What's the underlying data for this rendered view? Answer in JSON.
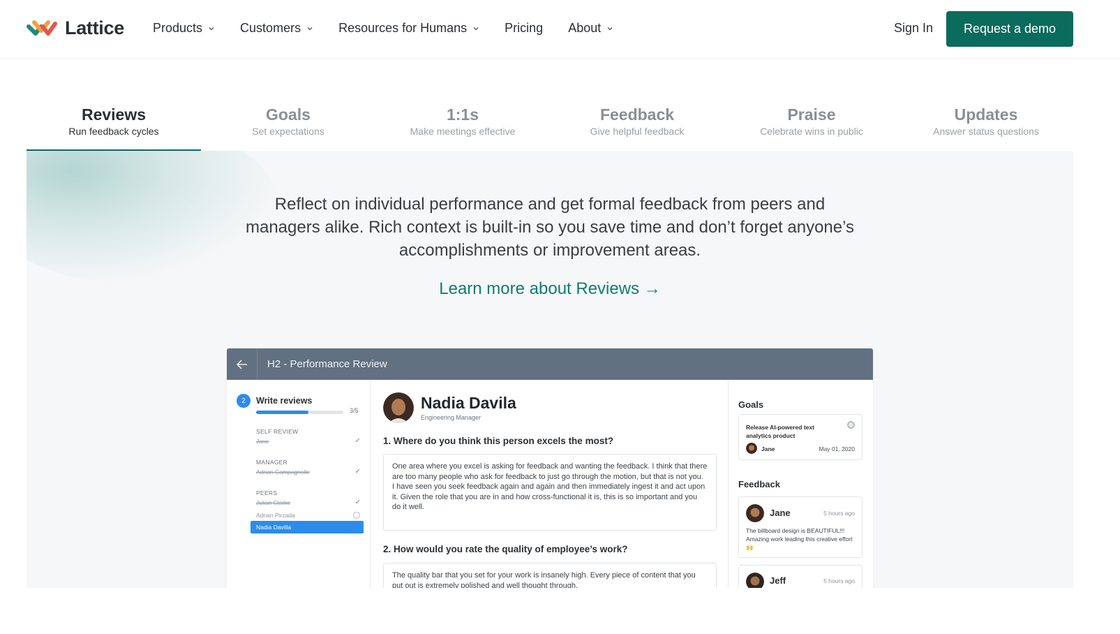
{
  "nav": {
    "brand": "Lattice",
    "menu": [
      {
        "label": "Products",
        "has_dropdown": true
      },
      {
        "label": "Customers",
        "has_dropdown": true
      },
      {
        "label": "Resources for Humans",
        "has_dropdown": true
      },
      {
        "label": "Pricing",
        "has_dropdown": false
      },
      {
        "label": "About",
        "has_dropdown": true
      }
    ],
    "sign_in": "Sign In",
    "cta": "Request a demo"
  },
  "tabs": [
    {
      "title": "Reviews",
      "subtitle": "Run feedback cycles",
      "active": true
    },
    {
      "title": "Goals",
      "subtitle": "Set expectations",
      "active": false
    },
    {
      "title": "1:1s",
      "subtitle": "Make meetings effective",
      "active": false
    },
    {
      "title": "Feedback",
      "subtitle": "Give helpful feedback",
      "active": false
    },
    {
      "title": "Praise",
      "subtitle": "Celebrate wins in public",
      "active": false
    },
    {
      "title": "Updates",
      "subtitle": "Answer status questions",
      "active": false
    }
  ],
  "panel": {
    "description": "Reflect on individual performance and get formal feedback from peers and managers alike. Rich context is built-in so you save time and don’t forget anyone’s accomplishments or improvement areas.",
    "learn_more": "Learn more about Reviews →"
  },
  "app": {
    "title": "H2 - Performance Review",
    "sidebar": {
      "step_number": "2",
      "step_label": "Write reviews",
      "progress_count": "3/5",
      "progress_fraction": 0.6,
      "groups": [
        {
          "label": "SELF REVIEW",
          "people": [
            {
              "name": "Jane",
              "status": "done"
            }
          ]
        },
        {
          "label": "MANAGER",
          "people": [
            {
              "name": "Adrian Campagnolle",
              "status": "done"
            }
          ]
        },
        {
          "label": "PEERS",
          "people": [
            {
              "name": "Julian Clarke",
              "status": "done"
            },
            {
              "name": "Adnan Pirzada",
              "status": "pending"
            },
            {
              "name": "Nadia Davilla",
              "status": "selected"
            }
          ]
        }
      ]
    },
    "employee": {
      "name": "Nadia Davila",
      "role": "Engineering Manager"
    },
    "questions": [
      {
        "question": "1. Where do you think this person excels the most?",
        "answer_line1": "One area where you excel is asking for feedback and wanting the feedback. I think that there are too many people who ask for feedback to just go through the motion, but that is not you.",
        "answer_line2": "I have seen you seek feedback again and again and then immediately ingest it and act upon it. Given the role that you are in and how cross-functional it is, this is so important and you do it well."
      },
      {
        "question": "2. How would you rate the quality of employee’s work?",
        "answer_line1": "The quality bar that you set for your work is insanely high. Every piece of content that you put out is extremely polished and well thought through."
      }
    ],
    "goals": {
      "heading": "Goals",
      "item": {
        "title": "Release AI-powered text analytics product",
        "owner": "Jane",
        "date": "May 01, 2020"
      }
    },
    "feedback": {
      "heading": "Feedback",
      "items": [
        {
          "name": "Jane",
          "time": "5 hours ago",
          "text": "The billboard design is BEAUTIFUL!!! Amazing work leading this creative effort 🙌"
        },
        {
          "name": "Jeff",
          "time": "5 hours ago"
        }
      ]
    }
  },
  "colors": {
    "brand": "#0b6b5d",
    "link": "#117d6e",
    "app_bar": "#627181",
    "accent_blue": "#2c8ceb"
  }
}
